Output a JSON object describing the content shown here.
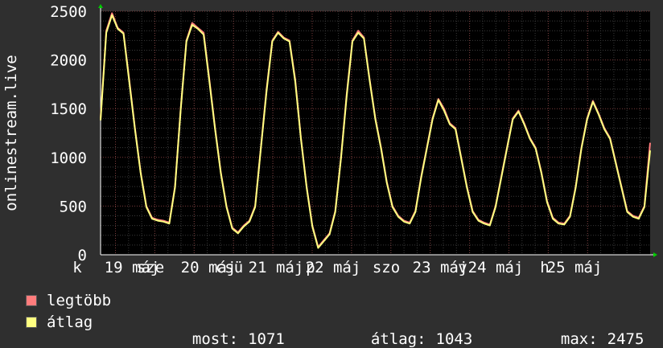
{
  "chart_data": {
    "type": "line",
    "ylabel": "onlinestream.live",
    "yticks": [
      0,
      500,
      1000,
      1500,
      2000,
      2500
    ],
    "ylim": [
      0,
      2500
    ],
    "x_start_tick_label": "k",
    "x_tick_labels": [
      "19 máj",
      "sze",
      "20 máj",
      "csü",
      "21 máj",
      "p",
      "22 máj",
      "szo",
      "23 máj",
      "v",
      "24 máj",
      "h",
      "25 máj"
    ],
    "grid": true,
    "series": [
      {
        "name": "legtöbb",
        "color": "#ff7c7c",
        "values": [
          1400,
          2300,
          2480,
          2330,
          2280,
          1800,
          1300,
          850,
          500,
          380,
          360,
          350,
          330,
          700,
          1500,
          2200,
          2380,
          2330,
          2280,
          1800,
          1300,
          850,
          500,
          280,
          230,
          300,
          350,
          500,
          1100,
          1700,
          2200,
          2290,
          2230,
          2200,
          1800,
          1200,
          700,
          300,
          80,
          150,
          220,
          450,
          1000,
          1650,
          2200,
          2300,
          2230,
          1800,
          1400,
          1100,
          750,
          500,
          400,
          350,
          330,
          450,
          800,
          1100,
          1400,
          1600,
          1500,
          1350,
          1300,
          1000,
          700,
          450,
          360,
          330,
          310,
          500,
          800,
          1100,
          1400,
          1480,
          1350,
          1200,
          1100,
          850,
          550,
          380,
          330,
          320,
          400,
          700,
          1100,
          1400,
          1580,
          1450,
          1300,
          1200,
          950,
          700,
          450,
          400,
          380,
          500,
          1150
        ]
      },
      {
        "name": "átlag",
        "color": "#ffff80",
        "values": [
          1380,
          2280,
          2460,
          2320,
          2270,
          1780,
          1290,
          840,
          490,
          370,
          350,
          340,
          320,
          690,
          1490,
          2190,
          2360,
          2320,
          2260,
          1780,
          1290,
          840,
          490,
          270,
          220,
          290,
          340,
          490,
          1090,
          1680,
          2190,
          2280,
          2220,
          2190,
          1780,
          1190,
          690,
          290,
          70,
          140,
          210,
          440,
          990,
          1630,
          2190,
          2280,
          2220,
          1790,
          1390,
          1090,
          740,
          490,
          390,
          340,
          320,
          440,
          790,
          1090,
          1390,
          1590,
          1480,
          1340,
          1290,
          990,
          690,
          440,
          350,
          320,
          300,
          490,
          790,
          1090,
          1390,
          1470,
          1340,
          1190,
          1090,
          840,
          540,
          370,
          320,
          310,
          390,
          690,
          1090,
          1390,
          1570,
          1440,
          1290,
          1190,
          940,
          690,
          440,
          390,
          370,
          490,
          1071
        ]
      }
    ]
  },
  "legend": [
    {
      "label": "legtöbb",
      "color": "#ff7c7c"
    },
    {
      "label": "átlag",
      "color": "#ffff80"
    }
  ],
  "stats": [
    {
      "label": "most:",
      "value": "1071"
    },
    {
      "label": "átlag:",
      "value": "1043"
    },
    {
      "label": "max:",
      "value": "2475"
    }
  ]
}
